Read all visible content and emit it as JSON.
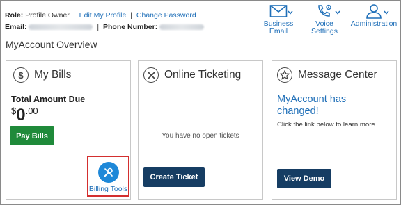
{
  "header": {
    "role_label": "Role:",
    "role_value": "Profile Owner",
    "edit_profile": "Edit My Profile",
    "divider": "|",
    "change_password": "Change Password",
    "email_label": "Email:",
    "phone_label": "Phone Number:",
    "icons": [
      {
        "label_line1": "Business",
        "label_line2": "Email",
        "icon": "envelope-icon"
      },
      {
        "label_line1": "Voice",
        "label_line2": "Settings",
        "icon": "phone-gear-icon"
      },
      {
        "label_line1": "Administration",
        "label_line2": "",
        "icon": "user-icon"
      }
    ]
  },
  "page_title": "MyAccount Overview",
  "cards": {
    "bills": {
      "title": "My Bills",
      "icon": "dollar-circle-icon",
      "total_label": "Total Amount Due",
      "currency": "$",
      "amount_whole": "0",
      "amount_cents": ".00",
      "pay_button": "Pay Bills",
      "tools_label": "Billing Tools",
      "tools_icon": "wrench-screwdriver-icon",
      "highlight_color": "#d32f2f"
    },
    "ticketing": {
      "title": "Online Ticketing",
      "icon": "tools-circle-icon",
      "empty_message": "You have no open tickets",
      "create_button": "Create Ticket"
    },
    "messages": {
      "title": "Message Center",
      "icon": "star-circle-icon",
      "headline": "MyAccount has changed!",
      "body": "Click the link below to learn more.",
      "demo_button": "View Demo"
    }
  },
  "colors": {
    "link": "#1f6fb8",
    "green_button": "#1f8a3a",
    "navy_button": "#163d63",
    "tools_icon_bg": "#1e88d8"
  }
}
